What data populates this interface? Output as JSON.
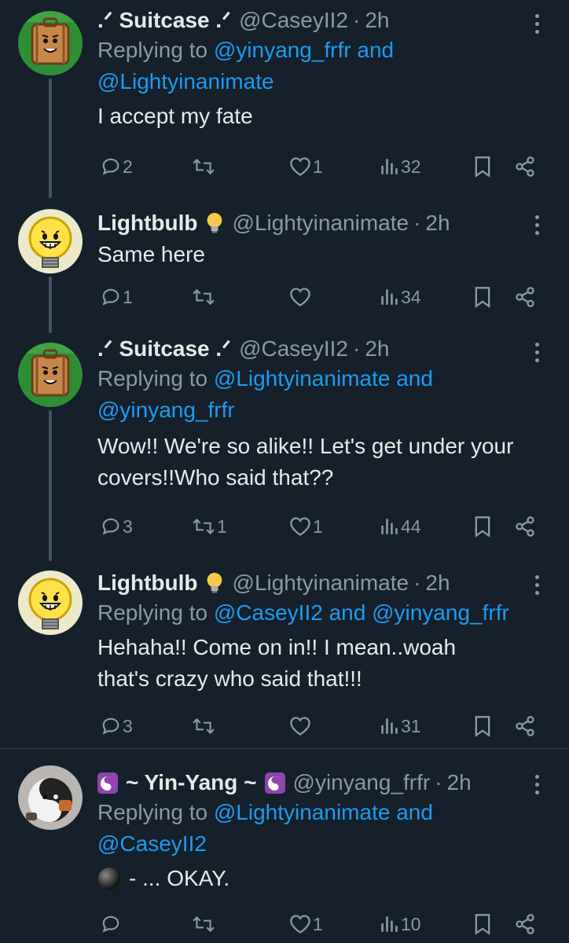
{
  "tweets": [
    {
      "name": ".ᐟ Suitcase .ᐟ",
      "handle": "@CaseyII2",
      "dot": "·",
      "time": "2h",
      "replying_prefix": "Replying to",
      "replying_line1_mentions": "@yinyang_frfr",
      "replying_and": "and",
      "replying_line2_mention": "@Lightyinanimate",
      "text": "I accept my fate",
      "replies": "2",
      "reposts": "",
      "likes": "1",
      "views": "32",
      "avatar": "suitcase"
    },
    {
      "name": "Lightbulb",
      "handle": "@Lightyinanimate",
      "dot": "·",
      "time": "2h",
      "text": "Same here",
      "replies": "1",
      "reposts": "",
      "likes": "",
      "views": "34",
      "avatar": "lightbulb",
      "name_emoji": "lightbulb-emoji"
    },
    {
      "name": ".ᐟ Suitcase .ᐟ",
      "handle": "@CaseyII2",
      "dot": "·",
      "time": "2h",
      "replying_prefix": "Replying to",
      "replying_line1_mentions": "@Lightyinanimate",
      "replying_and": "and",
      "replying_line2_mention": "@yinyang_frfr",
      "text_line1": "Wow!! We're so alike!! Let's get under your",
      "text_line2": "covers!!Who said that??",
      "replies": "3",
      "reposts": "1",
      "likes": "1",
      "views": "44",
      "avatar": "suitcase"
    },
    {
      "name": "Lightbulb",
      "handle": "@Lightyinanimate",
      "dot": "·",
      "time": "2h",
      "replying_prefix": "Replying to",
      "replying_mention_a": "@CaseyII2",
      "replying_and": "and",
      "replying_mention_b": "@yinyang_frfr",
      "text_line1": "Hehaha!! Come on in!! I mean..woah",
      "text_line2": "that's crazy who said that!!!",
      "replies": "3",
      "reposts": "",
      "likes": "",
      "views": "31",
      "avatar": "lightbulb",
      "name_emoji": "lightbulb-emoji"
    },
    {
      "name": "~ Yin-Yang ~",
      "handle": "@yinyang_frfr",
      "dot": "·",
      "time": "2h",
      "replying_prefix": "Replying to",
      "replying_line1_mentions": "@Lightyinanimate",
      "replying_and": "and",
      "replying_line2_mention": "@CaseyII2",
      "text": "- ... OKAY.",
      "replies": "",
      "reposts": "",
      "likes": "1",
      "views": "10",
      "avatar": "yinyang",
      "name_emoji": "yin-yang-emoji"
    }
  ],
  "colors": {
    "background": "#15202b",
    "text": "#e7e9ea",
    "secondary": "#8b98a5",
    "link": "#1d9bf0",
    "thread_line": "#425364"
  }
}
